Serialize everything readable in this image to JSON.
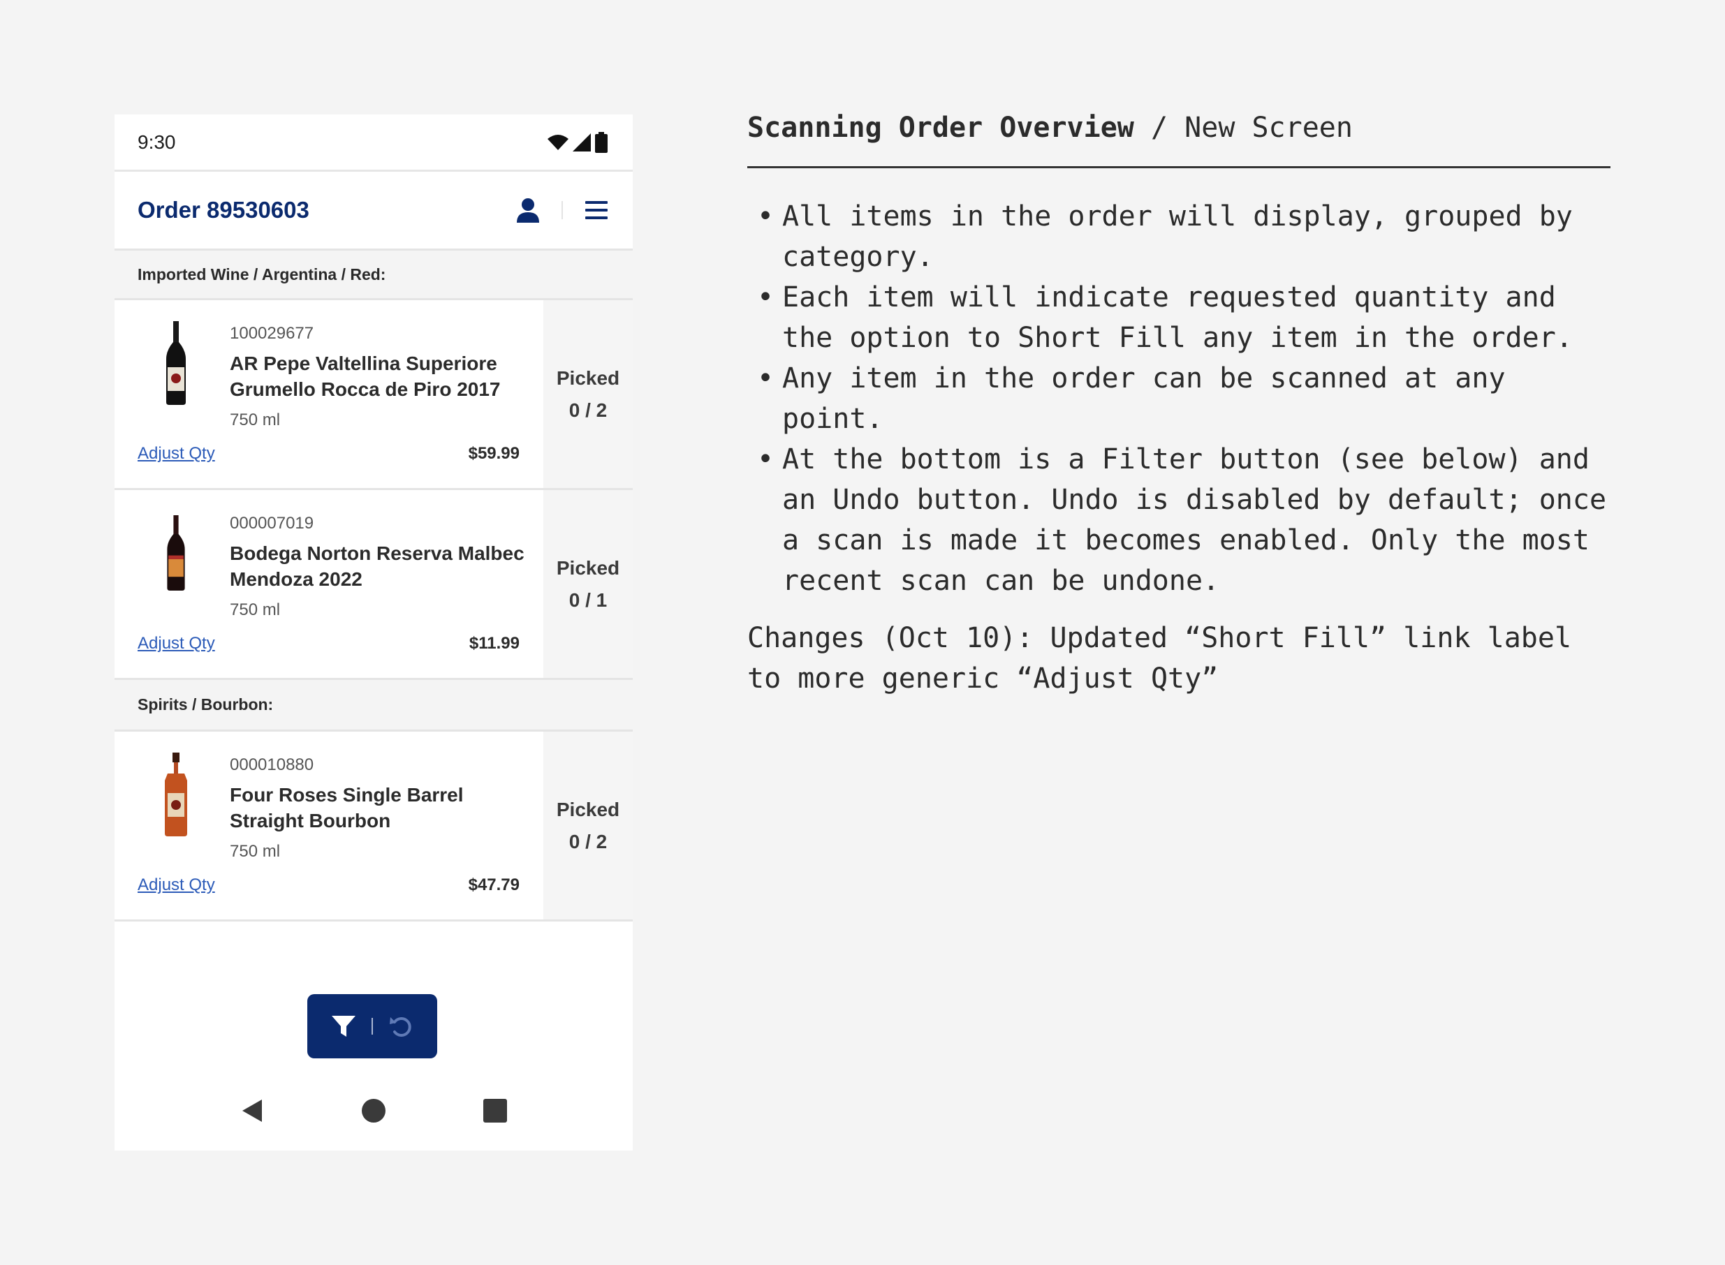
{
  "status_bar": {
    "time": "9:30"
  },
  "header": {
    "title": "Order 89530603"
  },
  "categories": [
    {
      "name": "Imported Wine / Argentina / Red:",
      "items": [
        {
          "sku": "100029677",
          "name": "AR Pepe Valtellina Superiore Grumello Rocca de Piro 2017",
          "size": "750 ml",
          "price": "$59.99",
          "adjust_label": "Adjust Qty",
          "picked_label": "Picked",
          "picked_count": "0 / 2"
        },
        {
          "sku": "000007019",
          "name": "Bodega Norton Reserva Malbec Mendoza 2022",
          "size": "750 ml",
          "price": "$11.99",
          "adjust_label": "Adjust Qty",
          "picked_label": "Picked",
          "picked_count": "0 / 1"
        }
      ]
    },
    {
      "name": "Spirits / Bourbon:",
      "items": [
        {
          "sku": "000010880",
          "name": "Four Roses Single Barrel Straight Bourbon",
          "size": "750 ml",
          "price": "$47.79",
          "adjust_label": "Adjust Qty",
          "picked_label": "Picked",
          "picked_count": "0 / 2"
        }
      ]
    }
  ],
  "colors": {
    "brand": "#0b2a6e",
    "link": "#2c5bb8",
    "page_bg": "#f4f4f4"
  },
  "icons": {
    "user": "user-icon",
    "menu": "hamburger-menu-icon",
    "filter": "filter-icon",
    "undo": "undo-icon"
  },
  "notes": {
    "title": "Scanning Order Overview",
    "subtitle": "/ New Screen",
    "bullets": [
      "All items in the order will display, grouped by category.",
      "Each item will indicate requested quantity and the option to Short Fill any item in the order.",
      "Any item in the order can be scanned at any point.",
      "At the bottom is a Filter button (see below) and an Undo button. Undo is disabled by default; once a scan is made it becomes enabled. Only the most recent scan can be undone."
    ],
    "changes": "Changes (Oct 10): Updated “Short Fill” link label to more generic “Adjust Qty”"
  }
}
